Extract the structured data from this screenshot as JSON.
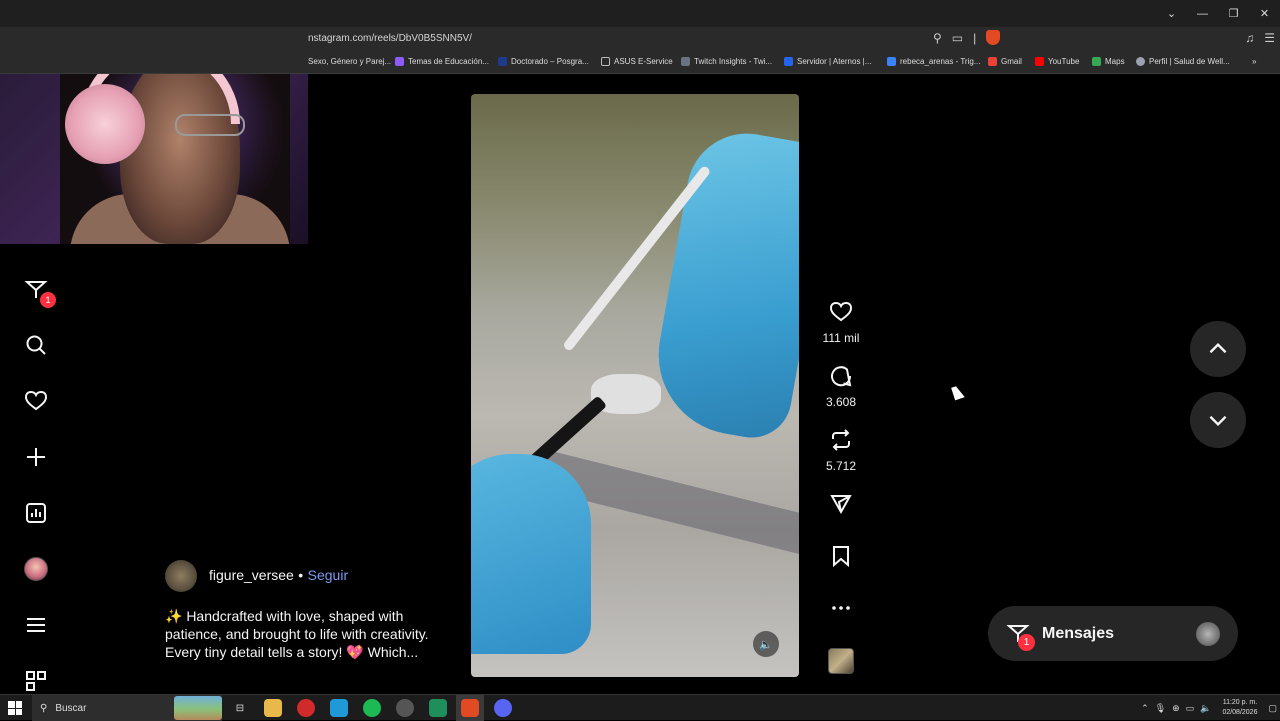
{
  "browser": {
    "url": "nstagram.com/reels/DbV0B5SNN5V/",
    "bookmarks": [
      {
        "label": "Sexo, Género y Parej...",
        "color": "#c9463d"
      },
      {
        "label": "Temas de Educación...",
        "color": "#8b5cf6"
      },
      {
        "label": "Doctorado – Posgra...",
        "color": "#1e3a8a"
      },
      {
        "label": "ASUS E-Service",
        "color": "#888888"
      },
      {
        "label": "Twitch Insights - Twi...",
        "color": "#6b7280"
      },
      {
        "label": "Servidor | Aternos |...",
        "color": "#2563eb"
      },
      {
        "label": "rebeca_arenas - Trig...",
        "color": "#3b82f6"
      },
      {
        "label": "Gmail",
        "color": "#ea4335"
      },
      {
        "label": "YouTube",
        "color": "#ff0000"
      },
      {
        "label": "Maps",
        "color": "#34a853"
      },
      {
        "label": "Perfil | Salud de Well...",
        "color": "#9ca3af"
      }
    ]
  },
  "sidebar": {
    "items": [
      {
        "name": "home-icon"
      },
      {
        "name": "reels-icon"
      },
      {
        "name": "messages-icon",
        "badge": "1"
      },
      {
        "name": "search-icon"
      },
      {
        "name": "notifications-icon"
      },
      {
        "name": "create-icon"
      },
      {
        "name": "dashboard-icon"
      },
      {
        "name": "profile-avatar"
      },
      {
        "name": "menu-icon"
      },
      {
        "name": "more-apps-icon"
      }
    ]
  },
  "reel": {
    "username": "figure_versee",
    "follow_label": "Seguir",
    "separator": "•",
    "caption_line1": "✨ Handcrafted with love, shaped with",
    "caption_line2": "patience, and brought to life with creativity.",
    "caption_line3": "Every tiny detail tells a story! 💖 Which..."
  },
  "actions": {
    "likes": "111 mil",
    "comments": "3.608",
    "reposts": "5.712"
  },
  "messages_dock": {
    "label": "Mensajes",
    "badge": "1"
  },
  "taskbar": {
    "search_placeholder": "Buscar",
    "time": "11:20 p. m.",
    "date": "02/08/2026"
  }
}
